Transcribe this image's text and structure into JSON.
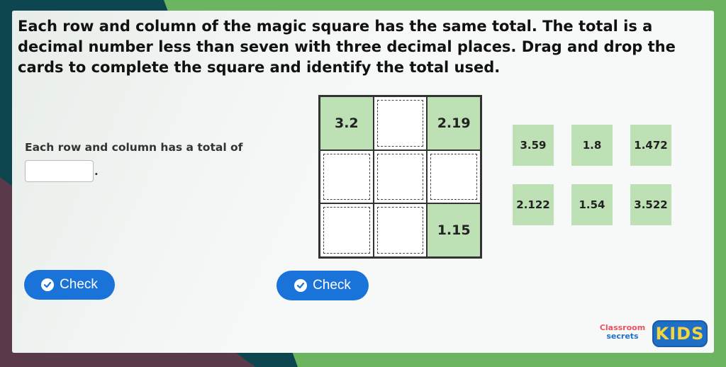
{
  "question": {
    "text": "Each row and column of the magic square has the same total. The total is a decimal number less than seven with three decimal places. Drag and drop the cards to complete the square and identify the total used."
  },
  "answer": {
    "label": "Each row and column has a total of",
    "input_value": "",
    "period": "."
  },
  "buttons": {
    "check_left": "Check",
    "check_center": "Check"
  },
  "magic_square": {
    "cells": [
      "3.2",
      "",
      "2.19",
      "",
      "",
      "",
      "",
      "",
      "1.15"
    ]
  },
  "cards": [
    "3.59",
    "1.8",
    "1.472",
    "2.122",
    "1.54",
    "3.522"
  ],
  "logo": {
    "line1": "Classroom",
    "line2": "secrets",
    "kids": "KIDS"
  },
  "colors": {
    "tile": "#bde0b5",
    "button": "#1a73d9",
    "frame": "#6db460"
  },
  "icons": [
    "check-circle-icon"
  ]
}
